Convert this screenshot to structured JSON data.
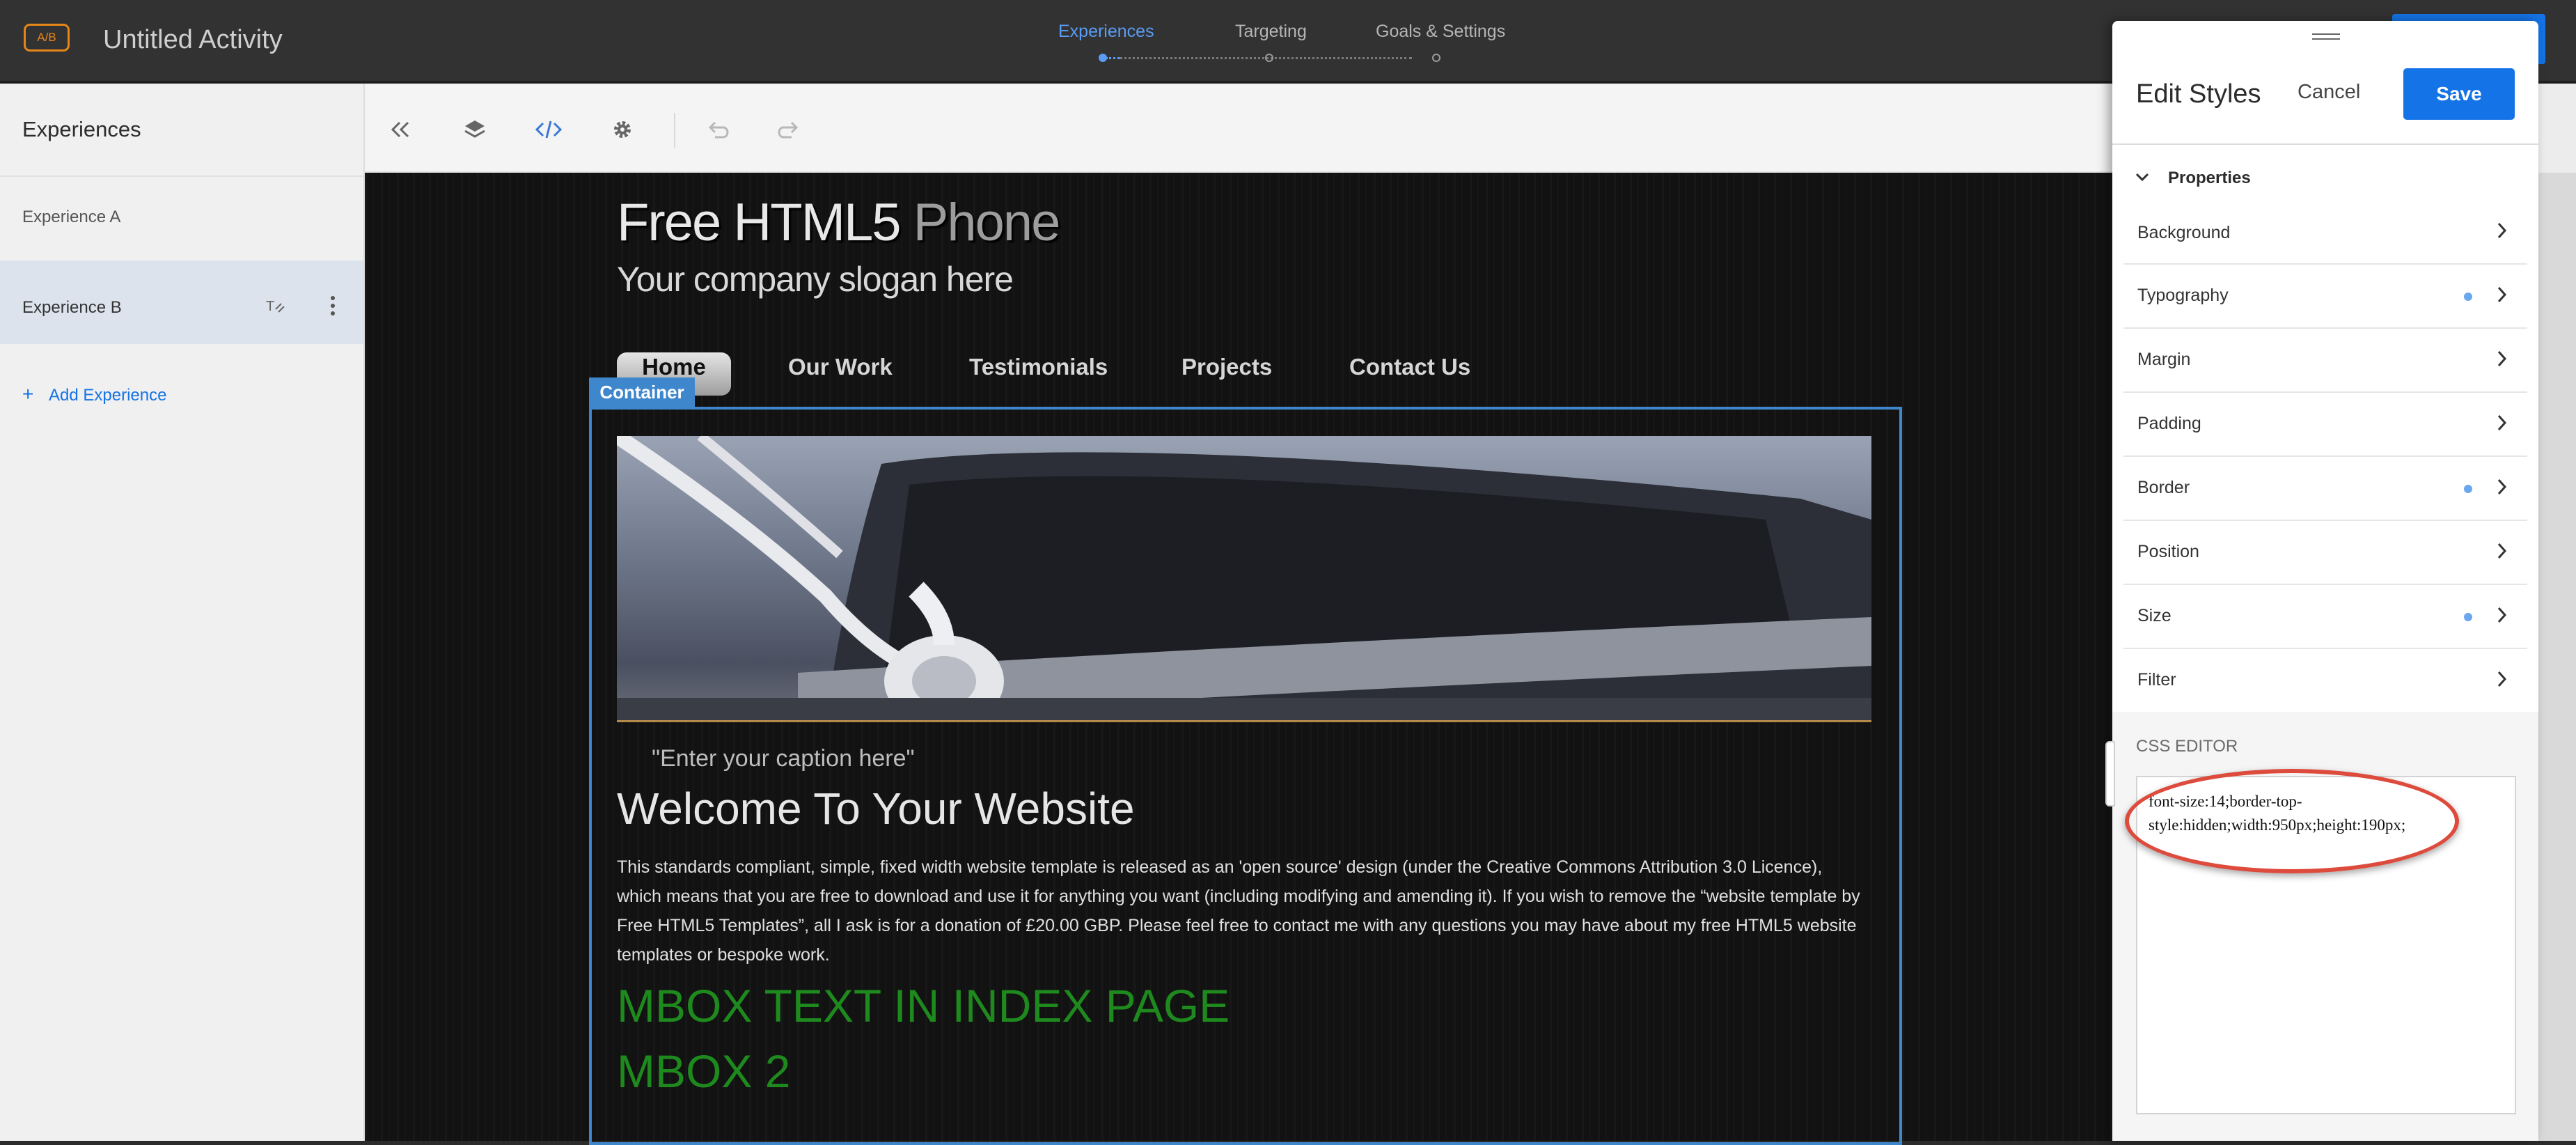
{
  "header": {
    "badge": "A/B",
    "title": "Untitled Activity",
    "steps": [
      {
        "label": "Experiences",
        "active": true
      },
      {
        "label": "Targeting",
        "active": false
      },
      {
        "label": "Goals & Settings",
        "active": false
      }
    ]
  },
  "experiences": {
    "heading": "Experiences",
    "items": [
      {
        "label": "Experience A",
        "selected": false
      },
      {
        "label": "Experience B",
        "selected": true
      }
    ],
    "add_label": "Add Experience"
  },
  "toolbar": {
    "icons": [
      "collapse-left-icon",
      "layers-icon",
      "code-icon",
      "settings-icon",
      "undo-icon",
      "redo-icon"
    ]
  },
  "site": {
    "title_main": "Free HTML5",
    "title_accent": "Phone",
    "slogan": "Your company slogan here",
    "nav": [
      "Home",
      "Our Work",
      "Testimonials",
      "Projects",
      "Contact Us"
    ],
    "container_tag": "Container",
    "caption": "\"Enter your caption here\"",
    "welcome": "Welcome To Your Website",
    "intro": "This standards compliant, simple, fixed width website template is released as an 'open source' design (under the Creative Commons Attribution 3.0 Licence), which means that you are free to download and use it for anything you want (including modifying and amending it). If you wish to remove the “website template by Free HTML5 Templates”, all I ask is for a donation of £20.00 GBP. Please feel free to contact me with any questions you may have about my free HTML5 website templates or bespoke work.",
    "mbox1": "MBOX TEXT IN INDEX PAGE",
    "mbox2": "MBOX 2"
  },
  "panel": {
    "title": "Edit Styles",
    "cancel": "Cancel",
    "save": "Save",
    "properties_heading": "Properties",
    "properties": [
      {
        "label": "Background",
        "modified": false
      },
      {
        "label": "Typography",
        "modified": true
      },
      {
        "label": "Margin",
        "modified": false
      },
      {
        "label": "Padding",
        "modified": false
      },
      {
        "label": "Border",
        "modified": true
      },
      {
        "label": "Position",
        "modified": false
      },
      {
        "label": "Size",
        "modified": true
      },
      {
        "label": "Filter",
        "modified": false
      }
    ],
    "css_heading": "CSS EDITOR",
    "css_value": "font-size:14;border-top-style:hidden;width:950px;height:190px;"
  },
  "colors": {
    "accent": "#1473e6",
    "badge": "#e68619",
    "container_outline": "#3f87cd",
    "mbox_text": "#1e8a1e",
    "highlight_circle": "#dd4b3d",
    "modified_dot": "#6aa7ef"
  }
}
